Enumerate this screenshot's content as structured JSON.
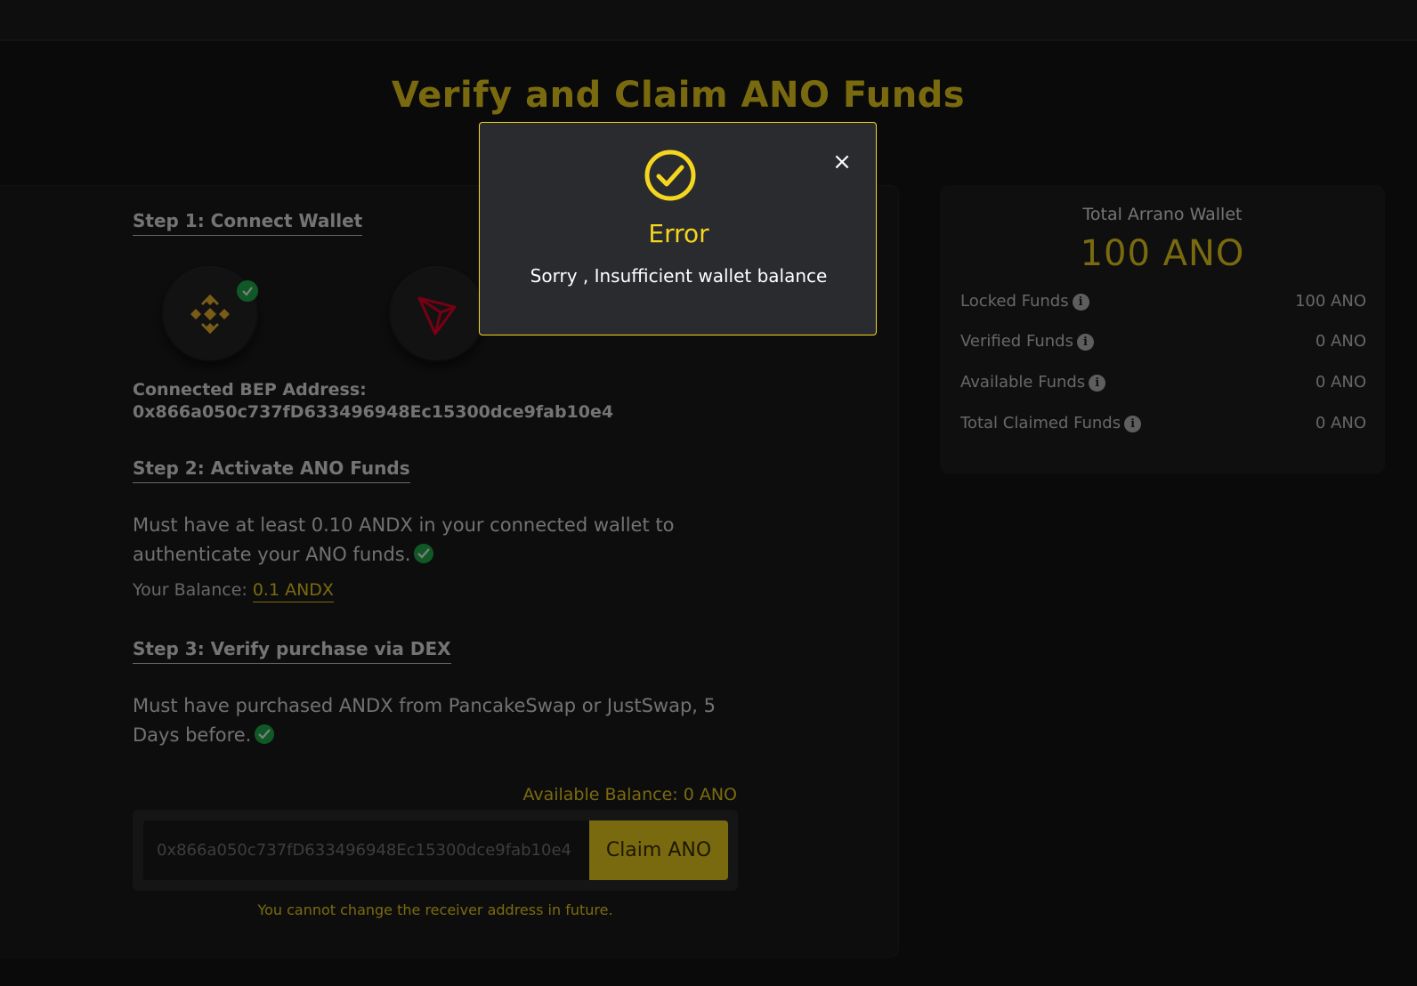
{
  "page": {
    "title": "Verify and Claim ANO Funds"
  },
  "step1": {
    "heading": "Step 1: Connect Wallet",
    "wallets": [
      {
        "icon": "binance-icon",
        "connected": true
      },
      {
        "icon": "tron-icon",
        "connected": false
      }
    ],
    "address_label": "Connected BEP Address:",
    "address": "0x866a050c737fD633496948Ec15300dce9fab10e4"
  },
  "step2": {
    "heading": "Step 2: Activate ANO Funds",
    "text": "Must have at least 0.10 ANDX in your connected wallet to authenticate your ANO funds.",
    "balance_label": "Your Balance:",
    "balance_value": "0.1 ANDX"
  },
  "step3": {
    "heading": "Step 3: Verify purchase via DEX",
    "text": "Must have purchased ANDX from PancakeSwap or JustSwap, 5 Days before."
  },
  "claim": {
    "available_balance": "Available Balance: 0 ANO",
    "input_value": "0x866a050c737fD633496948Ec15300dce9fab10e4",
    "button_label": "Claim ANO",
    "warning": "You cannot change the receiver address in future."
  },
  "wallet_summary": {
    "title": "Total Arrano Wallet",
    "total": "100 ANO",
    "rows": [
      {
        "label": "Locked Funds",
        "value": "100 ANO"
      },
      {
        "label": "Verified Funds",
        "value": "0 ANO"
      },
      {
        "label": "Available Funds",
        "value": "0 ANO"
      },
      {
        "label": "Total Claimed Funds",
        "value": "0 ANO"
      }
    ],
    "info_icon": "i"
  },
  "modal": {
    "icon": "check-circle-icon",
    "title": "Error",
    "message": "Sorry , Insufficient wallet balance",
    "close_label": "×"
  },
  "colors": {
    "accent": "#f4d51f",
    "success": "#21b24d",
    "background": "#141414",
    "card": "#1b1b1b",
    "binance": "#f3ba2f",
    "tron": "#ef0027"
  }
}
